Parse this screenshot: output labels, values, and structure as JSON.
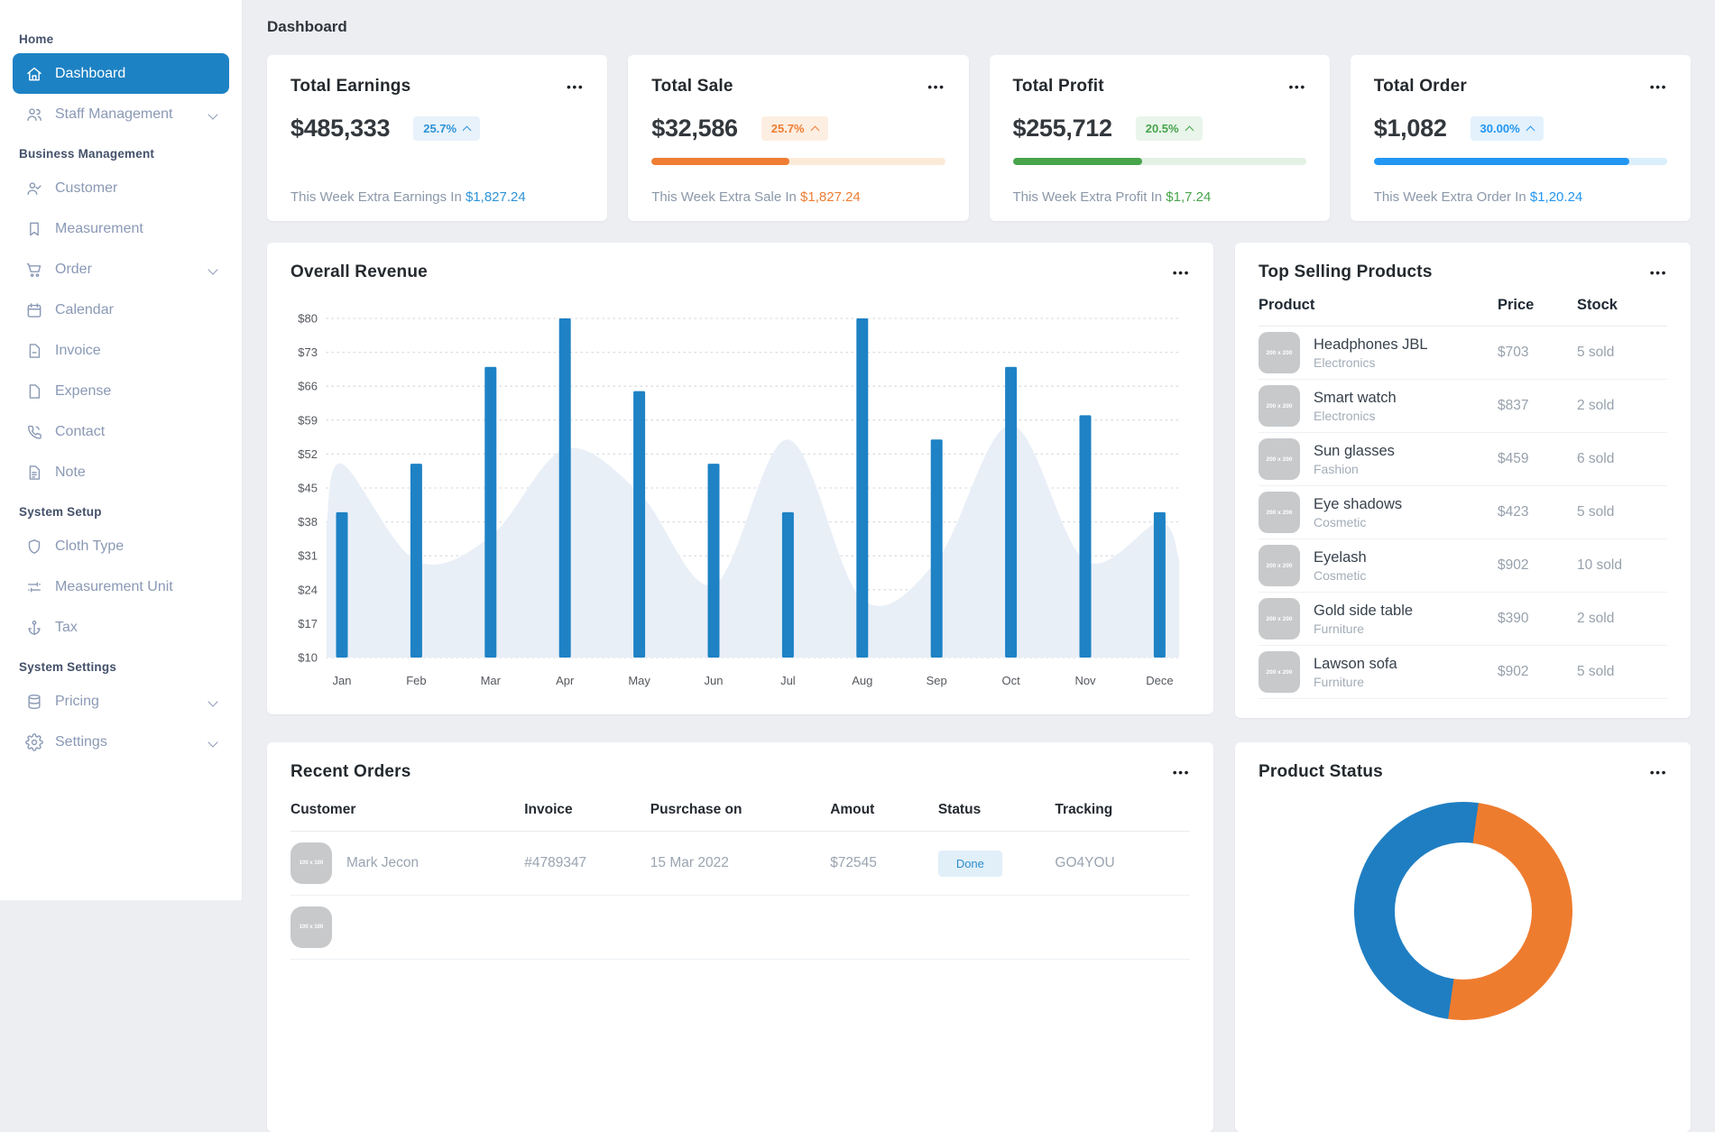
{
  "page_title": "Dashboard",
  "icons": {
    "more": "•••"
  },
  "sidebar": {
    "sections": [
      {
        "label": "Home",
        "items": [
          {
            "icon": "home-icon",
            "label": "Dashboard",
            "active": true,
            "chevron": false
          },
          {
            "icon": "staff-icon",
            "label": "Staff Management",
            "active": false,
            "chevron": true
          }
        ]
      },
      {
        "label": "Business Management",
        "items": [
          {
            "icon": "customer-icon",
            "label": "Customer",
            "chevron": false
          },
          {
            "icon": "measurement-icon",
            "label": "Measurement",
            "chevron": false
          },
          {
            "icon": "order-icon",
            "label": "Order",
            "chevron": true
          },
          {
            "icon": "calendar-icon",
            "label": "Calendar",
            "chevron": false
          },
          {
            "icon": "invoice-icon",
            "label": "Invoice",
            "chevron": false
          },
          {
            "icon": "expense-icon",
            "label": "Expense",
            "chevron": false
          },
          {
            "icon": "contact-icon",
            "label": "Contact",
            "chevron": false
          },
          {
            "icon": "note-icon",
            "label": "Note",
            "chevron": false
          }
        ]
      },
      {
        "label": "System Setup",
        "items": [
          {
            "icon": "cloth-type-icon",
            "label": "Cloth Type",
            "chevron": false
          },
          {
            "icon": "measurement-unit-icon",
            "label": "Measurement Unit",
            "chevron": false
          },
          {
            "icon": "tax-icon",
            "label": "Tax",
            "chevron": false
          }
        ]
      },
      {
        "label": "System Settings",
        "items": [
          {
            "icon": "pricing-icon",
            "label": "Pricing",
            "chevron": true
          },
          {
            "icon": "settings-icon",
            "label": "Settings",
            "chevron": true
          }
        ]
      }
    ]
  },
  "stats": [
    {
      "title": "Total Earnings",
      "value": "$485,333",
      "badge": "25.7%",
      "accent": "#2e93d6",
      "badge_bg": "#e8f2fb",
      "progress_pct": null,
      "track": null,
      "footer_text": "This Week Extra Earnings In",
      "footer_amount": "$1,827.24"
    },
    {
      "title": "Total Sale",
      "value": "$32,586",
      "badge": "25.7%",
      "accent": "#ef7d33",
      "badge_bg": "#fdeee2",
      "progress_pct": 47,
      "track": "#fcead9",
      "footer_text": "This Week Extra Sale In",
      "footer_amount": "$1,827.24"
    },
    {
      "title": "Total Profit",
      "value": "$255,712",
      "badge": "20.5%",
      "accent": "#47a44b",
      "badge_bg": "#e9f5ea",
      "progress_pct": 44,
      "track": "#e3f1e4",
      "footer_text": "This Week Extra Profit In",
      "footer_amount": "$1,7.24"
    },
    {
      "title": "Total Order",
      "value": "$1,082",
      "badge": "30.00%",
      "accent": "#2196f3",
      "badge_bg": "#e3f1fc",
      "progress_pct": 87,
      "track": "#dbeefb",
      "footer_text": "This Week Extra Order In",
      "footer_amount": "$1,20.24"
    }
  ],
  "panels": {
    "revenue": {
      "title": "Overall Revenue"
    },
    "products": {
      "title": "Top Selling Products",
      "columns": [
        "Product",
        "Price",
        "Stock"
      ],
      "image_placeholder": "200 x 200",
      "rows": [
        {
          "name": "Headphones JBL",
          "category": "Electronics",
          "price": "$703",
          "stock": "5 sold"
        },
        {
          "name": "Smart watch",
          "category": "Electronics",
          "price": "$837",
          "stock": "2 sold"
        },
        {
          "name": "Sun glasses",
          "category": "Fashion",
          "price": "$459",
          "stock": "6 sold"
        },
        {
          "name": "Eye shadows",
          "category": "Cosmetic",
          "price": "$423",
          "stock": "5 sold"
        },
        {
          "name": "Eyelash",
          "category": "Cosmetic",
          "price": "$902",
          "stock": "10 sold"
        },
        {
          "name": "Gold side table",
          "category": "Furniture",
          "price": "$390",
          "stock": "2 sold"
        },
        {
          "name": "Lawson sofa",
          "category": "Furniture",
          "price": "$902",
          "stock": "5 sold"
        }
      ]
    },
    "orders": {
      "title": "Recent Orders",
      "columns": [
        "Customer",
        "Invoice",
        "Pusrchase on",
        "Amout",
        "Status",
        "Tracking"
      ],
      "image_placeholder": "100 x 100",
      "rows": [
        {
          "customer": "Mark Jecon",
          "invoice": "#4789347",
          "purchase_on": "15 Mar 2022",
          "amount": "$72545",
          "status": "Done",
          "tracking": "GO4YOU"
        },
        {
          "customer": "",
          "invoice": "",
          "purchase_on": "",
          "amount": "",
          "status": "",
          "tracking": "",
          "partial": true
        }
      ]
    },
    "status": {
      "title": "Product Status"
    }
  },
  "chart_data": [
    {
      "type": "bar",
      "title": "Overall Revenue",
      "categories": [
        "Jan",
        "Feb",
        "Mar",
        "Apr",
        "May",
        "Jun",
        "Jul",
        "Aug",
        "Sep",
        "Oct",
        "Nov",
        "Dece"
      ],
      "series": [
        {
          "name": "revenue-bars",
          "type": "bar",
          "values": [
            40,
            50,
            70,
            80,
            65,
            50,
            40,
            80,
            55,
            70,
            60,
            40
          ]
        },
        {
          "name": "background-area",
          "type": "area",
          "values": [
            50,
            30,
            35,
            53,
            44,
            25,
            55,
            22,
            30,
            58,
            30,
            38
          ]
        }
      ],
      "ylim": [
        10,
        80
      ],
      "yticks": [
        "$80",
        "$73",
        "$66",
        "$59",
        "$52",
        "$45",
        "$38",
        "$31",
        "$24",
        "$17",
        "$10"
      ],
      "grid": "dashed-horizontal",
      "legend": "none",
      "bar_color": "#1e82c5",
      "area_color": "#e9eff7"
    },
    {
      "type": "pie",
      "title": "Product Status",
      "donut_hole_ratio": 0.63,
      "segments": [
        {
          "color": "#ee7c2f",
          "start_deg": 8,
          "end_deg": 188
        },
        {
          "color": "#1f7ec2",
          "start_deg": 188,
          "end_deg": 368
        }
      ]
    }
  ]
}
